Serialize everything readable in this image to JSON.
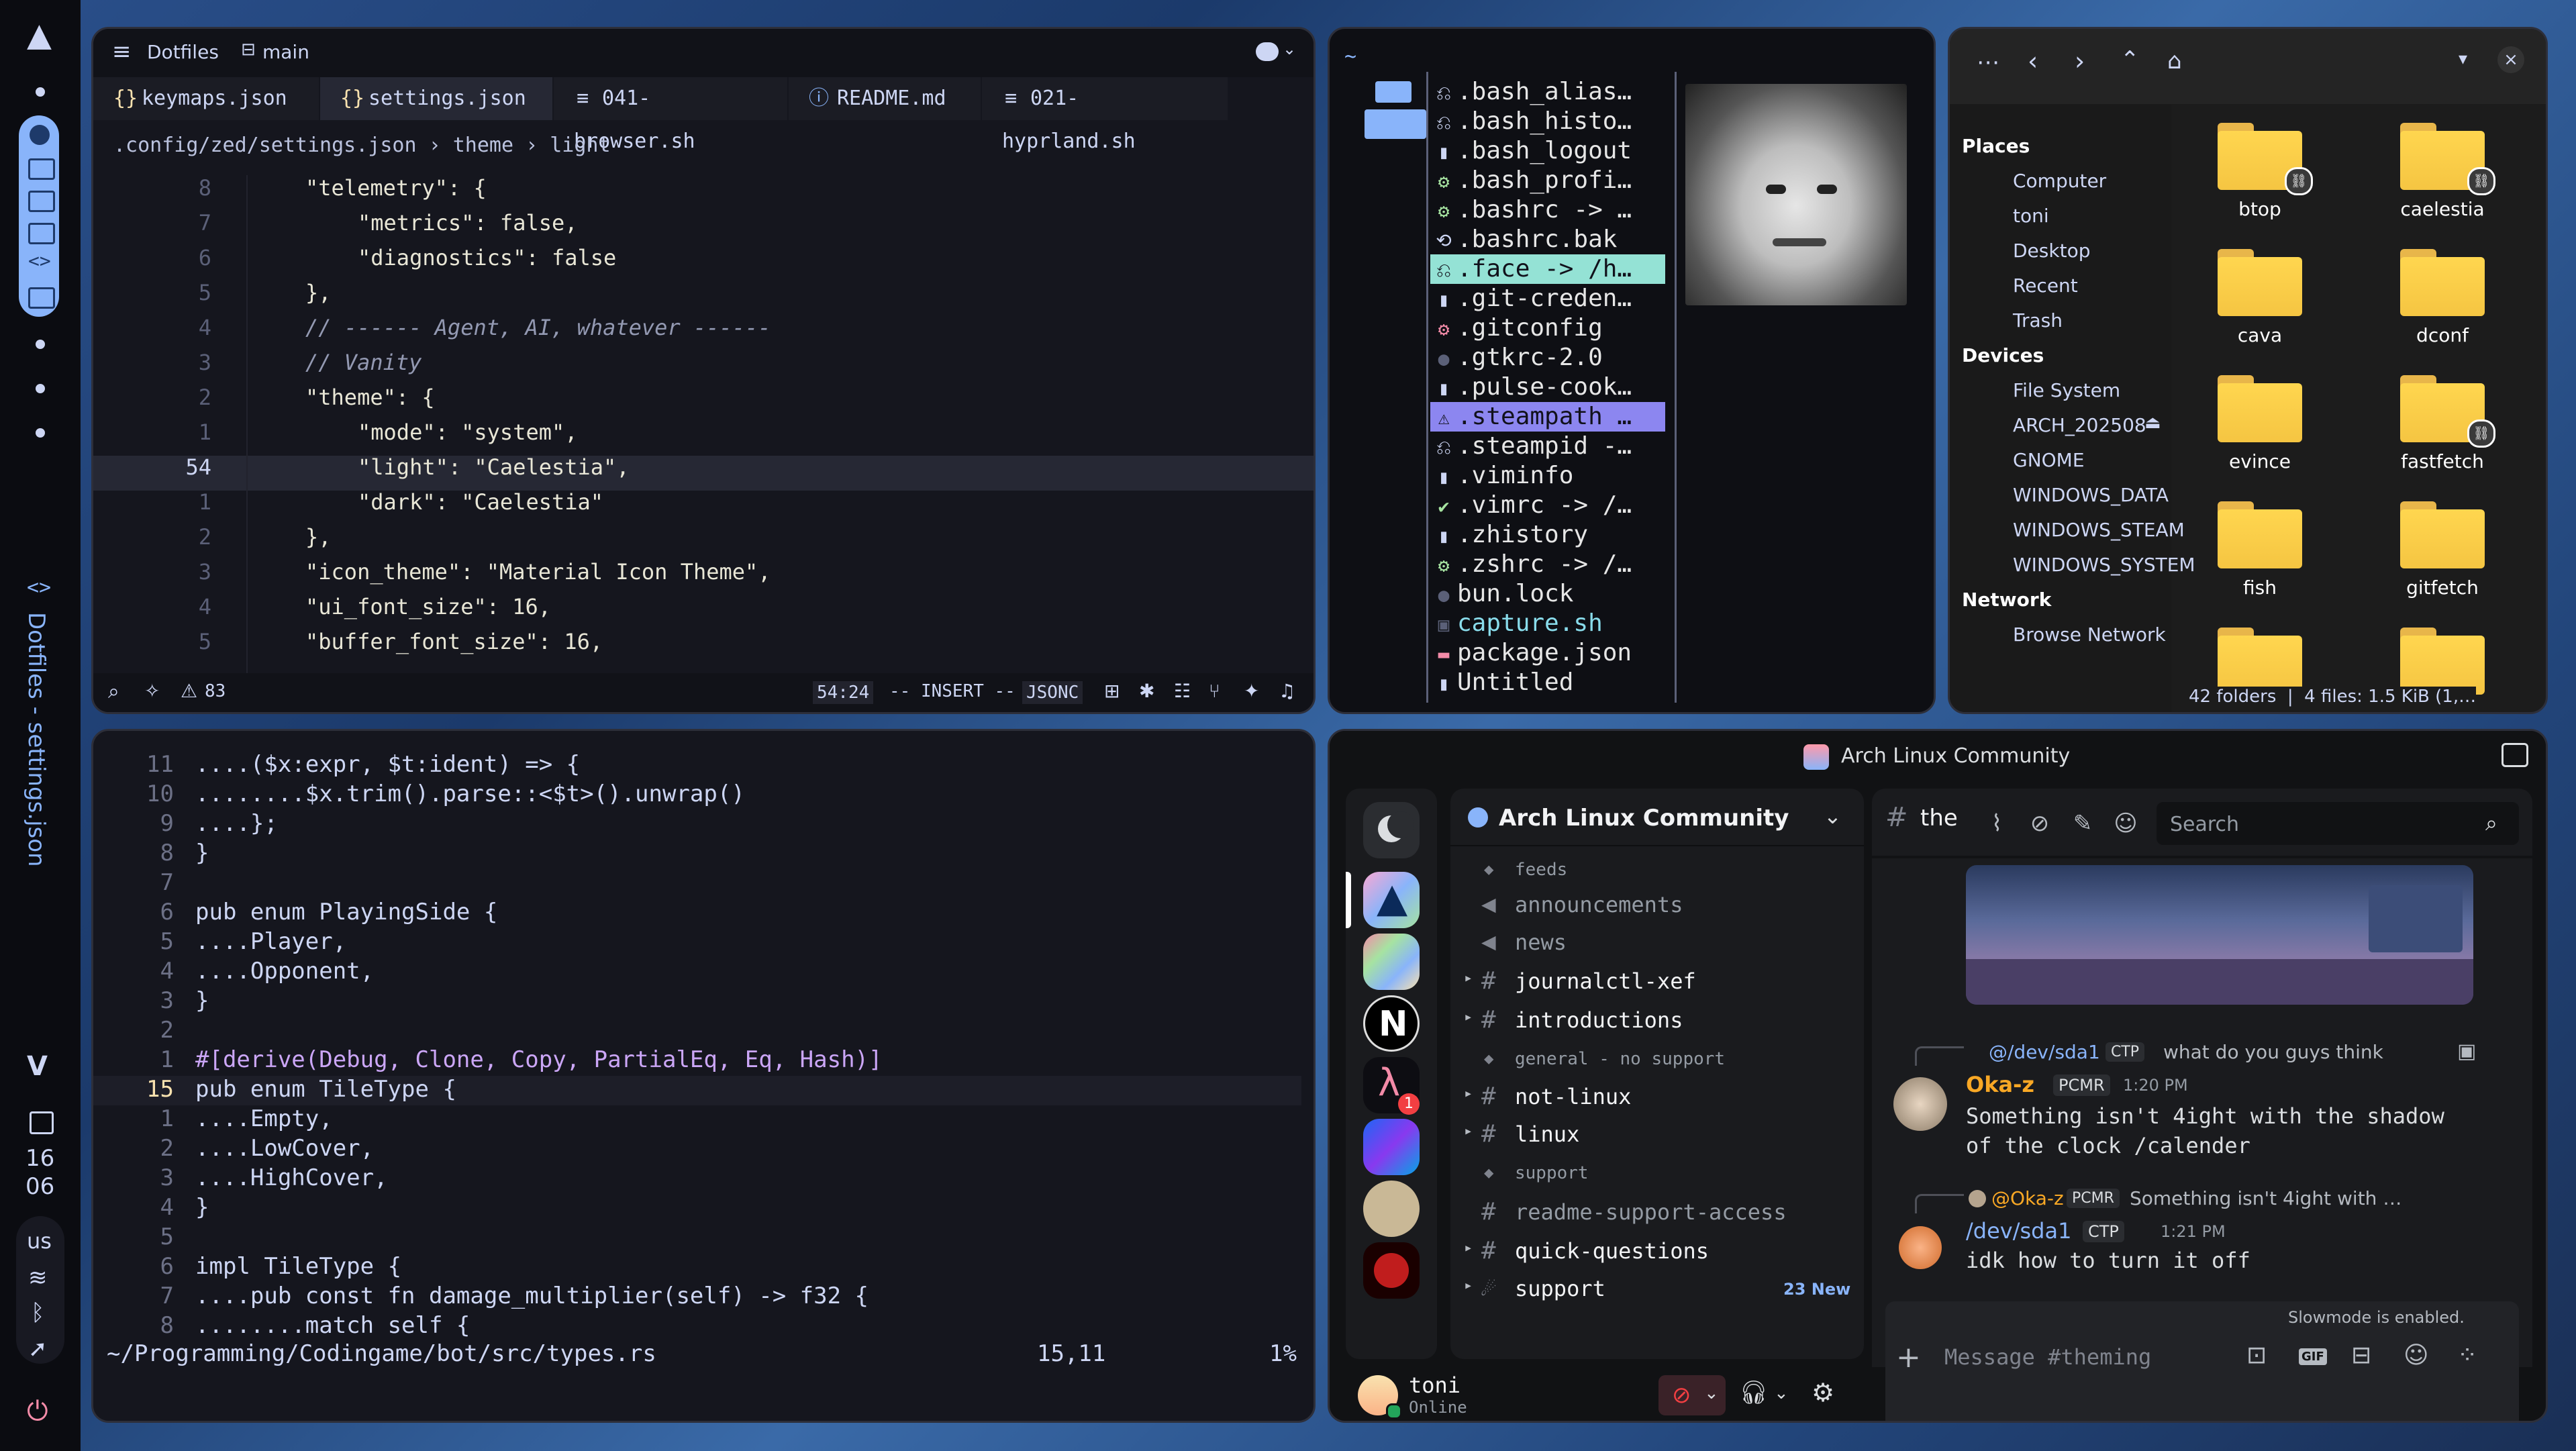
{
  "bar": {
    "workspace_title": "Dotfiles - settings.json",
    "clock_hour": "16",
    "clock_minute": "06",
    "keyboard_layout": "us",
    "vsc_label": "V"
  },
  "zed": {
    "title": "Dotfiles",
    "branch": "main",
    "tabs": [
      "keymaps.json",
      "settings.json",
      "041-browser.sh",
      "README.md",
      "021-hyprland.sh"
    ],
    "breadcrumb": [
      ".config/zed/settings.json",
      "theme",
      "light"
    ],
    "line_numbers": [
      "8",
      "7",
      "6",
      "5",
      "4",
      "3",
      "2",
      "1",
      "54",
      "1",
      "2",
      "3",
      "4",
      "5"
    ],
    "lines": [
      "\"telemetry\": {",
      "\"metrics\": false,",
      "\"diagnostics\": false",
      "},",
      "// ------ Agent, AI, whatever ------",
      "// Vanity",
      "\"theme\": {",
      "\"mode\": \"system\",",
      "\"light\": \"Caelestia\",",
      "\"dark\": \"Caelestia\"",
      "},",
      "\"icon_theme\": \"Material Icon Theme\",",
      "\"ui_font_size\": 16,",
      "\"buffer_font_size\": 16,"
    ],
    "status": {
      "warnings": "83",
      "position": "54:24",
      "mode": "-- INSERT --",
      "language": "JSONC"
    }
  },
  "yazi": {
    "cwd": "~",
    "files": [
      ".bash_alias…",
      ".bash_histo…",
      ".bash_logout",
      ".bash_profi…",
      ".bashrc -> …",
      ".bashrc.bak",
      ".face -> /h…",
      ".git-creden…",
      ".gitconfig",
      ".gtkrc-2.0",
      ".pulse-cook…",
      ".steampath …",
      ".steampid -…",
      ".viminfo",
      ".vimrc -> /…",
      ".zhistory",
      ".zshrc -> /…",
      "bun.lock",
      "capture.sh",
      "package.json",
      "Untitled"
    ]
  },
  "nautilus": {
    "places_title": "Places",
    "places": [
      "Computer",
      "toni",
      "Desktop",
      "Recent",
      "Trash"
    ],
    "devices_title": "Devices",
    "devices": [
      "File System",
      "ARCH_202508",
      "GNOME",
      "WINDOWS_DATA",
      "WINDOWS_STEAM",
      "WINDOWS_SYSTEM"
    ],
    "network_title": "Network",
    "network": [
      "Browse Network"
    ],
    "folders": [
      "btop",
      "caelestia",
      "cava",
      "dconf",
      "evince",
      "fastfetch",
      "fish",
      "gitfetch",
      "",
      ""
    ],
    "status": "42 folders  |  4 files: 1.5 KiB (1,…"
  },
  "vim": {
    "line_numbers": [
      "11",
      "10",
      "9",
      "8",
      "7",
      "6",
      "5",
      "4",
      "3",
      "2",
      "1",
      "15",
      "1",
      "2",
      "3",
      "4",
      "5",
      "6",
      "7",
      "8"
    ],
    "lines": [
      "....($x:expr, $t:ident) => {",
      "........$x.trim().parse::<$t>().unwrap()",
      "....};",
      "}",
      "",
      "pub enum PlayingSide {",
      "....Player,",
      "....Opponent,",
      "}",
      "",
      "#[derive(Debug, Clone, Copy, PartialEq, Eq, Hash)]",
      "pub enum TileType {",
      "....Empty,",
      "....LowCover,",
      "....HighCover,",
      "}",
      "",
      "impl TileType {",
      "....pub const fn damage_multiplier(self) -> f32 {",
      "........match self {"
    ],
    "status_path": "~/Programming/Codingame/bot/src/types.rs",
    "status_pos": "15,11",
    "status_pct": "1%"
  },
  "discord": {
    "window_title": "Arch Linux Community",
    "server_name": "Arch Linux Community",
    "channels": [
      {
        "kind": "category",
        "label": "feeds"
      },
      {
        "kind": "announce",
        "label": "announcements"
      },
      {
        "kind": "announce",
        "label": "news"
      },
      {
        "kind": "text",
        "label": "journalctl-xef"
      },
      {
        "kind": "text",
        "label": "introductions"
      },
      {
        "kind": "category",
        "label": "general - no support"
      },
      {
        "kind": "text",
        "label": "not-linux"
      },
      {
        "kind": "text",
        "label": "linux"
      },
      {
        "kind": "category",
        "label": "support"
      },
      {
        "kind": "text",
        "label": "readme-support-access"
      },
      {
        "kind": "text",
        "label": "quick-questions"
      },
      {
        "kind": "forum",
        "label": "support"
      }
    ],
    "new_badge": "23 New",
    "current_channel": "the",
    "search_placeholder": "Search",
    "server_badge": "1",
    "messages": [
      {
        "reply_to": "@/dev/sda1",
        "reply_tag": "CTP",
        "reply_text": "what do you guys think",
        "author": "Oka-z",
        "tag": "PCMR",
        "time": "1:20 PM",
        "text": "Something isn't 4ight with the shadow of the clock /calender"
      },
      {
        "reply_to": "@Oka-z",
        "reply_tag": "PCMR",
        "reply_text": "Something isn't 4ight with …",
        "author": "/dev/sda1",
        "tag": "CTP",
        "time": "1:21 PM",
        "text": "idk how to turn it off"
      }
    ],
    "slowmode": "Slowmode is enabled.",
    "composer_placeholder": "Message #theming",
    "user": {
      "name": "toni",
      "status": "Online"
    },
    "gif_label": "GIF"
  }
}
